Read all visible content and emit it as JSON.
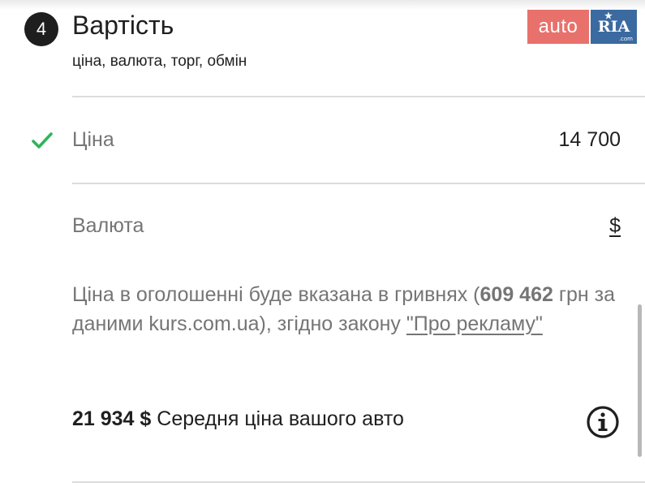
{
  "section": {
    "step_number": "4",
    "title": "Вартість",
    "subtitle": "ціна, валюта, торг, обмін"
  },
  "logo": {
    "part1": "auto",
    "part2": "RIA",
    "suffix": ".com"
  },
  "fields": {
    "price": {
      "label": "Ціна",
      "value": "14 700",
      "status": "filled"
    },
    "currency": {
      "label": "Валюта",
      "value": "$"
    }
  },
  "note": {
    "text_before": "Ціна в оголошенні буде вказана в гривнях (",
    "amount_uah": "609 462",
    "text_middle": " грн за даними kurs.com.ua), згідно закону ",
    "law_link": "\"Про рекламу\""
  },
  "average_price": {
    "amount": "21 934 $",
    "label": " Середня ціна вашого авто"
  },
  "colors": {
    "accent_check": "#2fb45a",
    "logo_auto": "#e8716c",
    "logo_ria": "#3b6aa0"
  }
}
